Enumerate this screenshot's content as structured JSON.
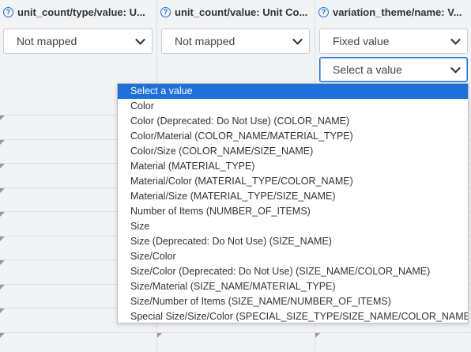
{
  "columns": [
    {
      "header": "unit_count/type/value: U...",
      "select_value": "Not mapped"
    },
    {
      "header": "unit_count/value: Unit Co...",
      "select_value": "Not mapped"
    },
    {
      "header": "variation_theme/name: V...",
      "select_value": "Fixed value",
      "value_select": "Select a value"
    }
  ],
  "dropdown": {
    "options": [
      "Select a value",
      "Color",
      "Color (Deprecated: Do Not Use) (COLOR_NAME)",
      "Color/Material (COLOR_NAME/MATERIAL_TYPE)",
      "Color/Size (COLOR_NAME/SIZE_NAME)",
      "Material (MATERIAL_TYPE)",
      "Material/Color (MATERIAL_TYPE/COLOR_NAME)",
      "Material/Size (MATERIAL_TYPE/SIZE_NAME)",
      "Number of Items (NUMBER_OF_ITEMS)",
      "Size",
      "Size (Deprecated: Do Not Use) (SIZE_NAME)",
      "Size/Color",
      "Size/Color (Deprecated: Do Not Use) (SIZE_NAME/COLOR_NAME)",
      "Size/Material (SIZE_NAME/MATERIAL_TYPE)",
      "Size/Number of Items (SIZE_NAME/NUMBER_OF_ITEMS)",
      "Special Size/Size/Color (SPECIAL_SIZE_TYPE/SIZE_NAME/COLOR_NAME)"
    ],
    "selected": "Select a value"
  },
  "colors": {
    "accent": "#1e6fd9",
    "background": "#f2f3f5",
    "border": "#dcdfe4"
  },
  "icons": {
    "help": "question-circle-icon",
    "chevron": "chevron-down-icon"
  }
}
